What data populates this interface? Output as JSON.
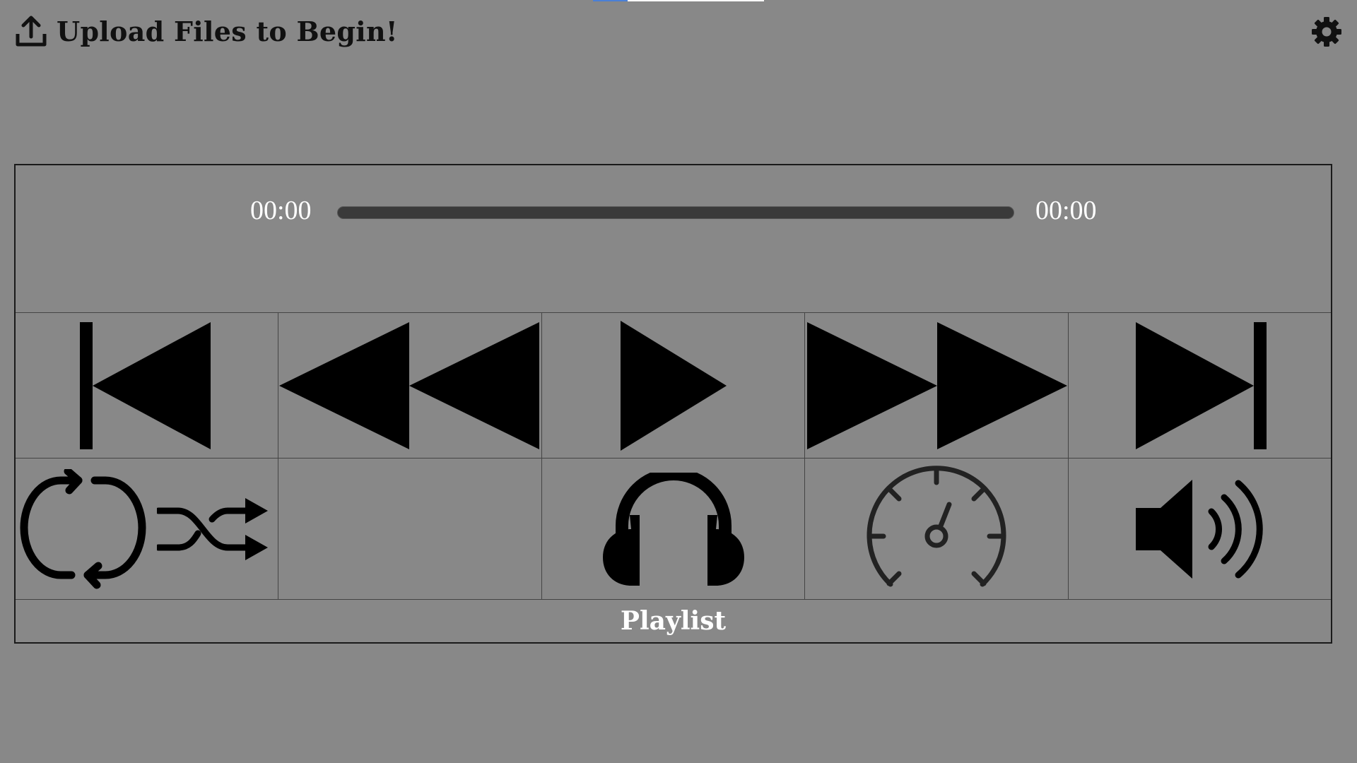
{
  "header": {
    "upload_label": "Upload Files to Begin!",
    "upload_icon": "upload-icon",
    "settings_icon": "gear-icon"
  },
  "player": {
    "current_time": "00:00",
    "total_time": "00:00",
    "progress_fraction": 0
  },
  "controls": [
    {
      "name": "skip-previous",
      "icon": "skip-previous-icon"
    },
    {
      "name": "rewind",
      "icon": "rewind-icon"
    },
    {
      "name": "play",
      "icon": "play-icon"
    },
    {
      "name": "fast-forward",
      "icon": "fast-forward-icon"
    },
    {
      "name": "skip-next",
      "icon": "skip-next-icon"
    }
  ],
  "tools": [
    {
      "name": "repeat-shuffle",
      "icons": [
        "repeat-icon",
        "shuffle-icon"
      ]
    },
    {
      "name": "empty"
    },
    {
      "name": "audio-output",
      "icon": "headphones-icon"
    },
    {
      "name": "playback-speed",
      "icon": "speedometer-icon"
    },
    {
      "name": "volume",
      "icon": "volume-icon"
    }
  ],
  "playlist": {
    "label": "Playlist"
  },
  "colors": {
    "background": "#888888",
    "icon": "#000000",
    "text_light": "#ffffff",
    "track": "#3a3a3a"
  }
}
